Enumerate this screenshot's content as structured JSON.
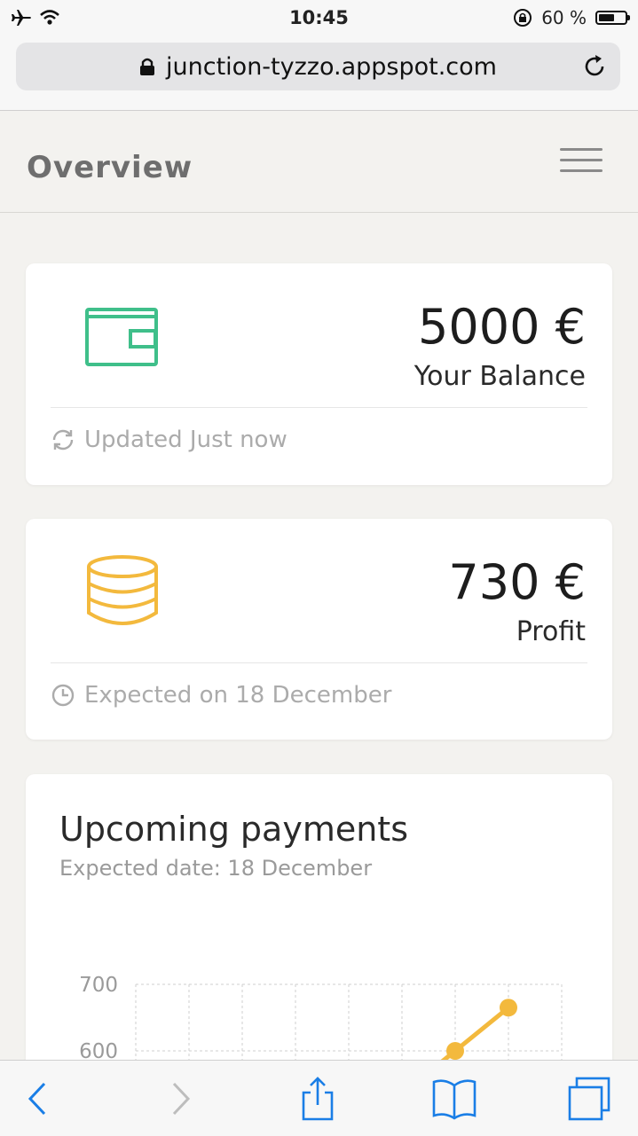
{
  "status_bar": {
    "time": "10:45",
    "battery_text": "60 %",
    "battery_level": 0.6,
    "icons": [
      "airplane-icon",
      "wifi-icon",
      "orientation-lock-icon",
      "battery-icon"
    ]
  },
  "browser": {
    "url": "junction-tyzzo.appspot.com",
    "icons": [
      "lock-icon",
      "reload-icon"
    ]
  },
  "header": {
    "title": "Overview",
    "menu_icon": "hamburger-icon"
  },
  "balance_card": {
    "amount": "5000 €",
    "label": "Your Balance",
    "footer": "Updated Just now",
    "icon": "wallet-icon",
    "footer_icon": "refresh-icon",
    "accent": "#3fbf8a"
  },
  "profit_card": {
    "amount": "730 €",
    "label": "Profit",
    "footer": "Expected on 18 December",
    "icon": "coins-icon",
    "footer_icon": "clock-icon",
    "accent": "#f3b93d"
  },
  "payments_card": {
    "title": "Upcoming payments",
    "subtitle": "Expected date: 18 December"
  },
  "chart_data": {
    "type": "line",
    "title": "Upcoming payments",
    "subtitle": "Expected date: 18 December",
    "y_ticks": [
      "700",
      "600"
    ],
    "ylim_visible": [
      600,
      700
    ],
    "series": [
      {
        "points_visible": [
          [
            7,
            600
          ],
          [
            8,
            665
          ]
        ]
      }
    ],
    "line_color": "#f3b93d",
    "grid": true
  },
  "toolbar": {
    "icons": [
      "back-icon",
      "forward-icon",
      "share-icon",
      "bookmarks-icon",
      "tabs-icon"
    ]
  }
}
